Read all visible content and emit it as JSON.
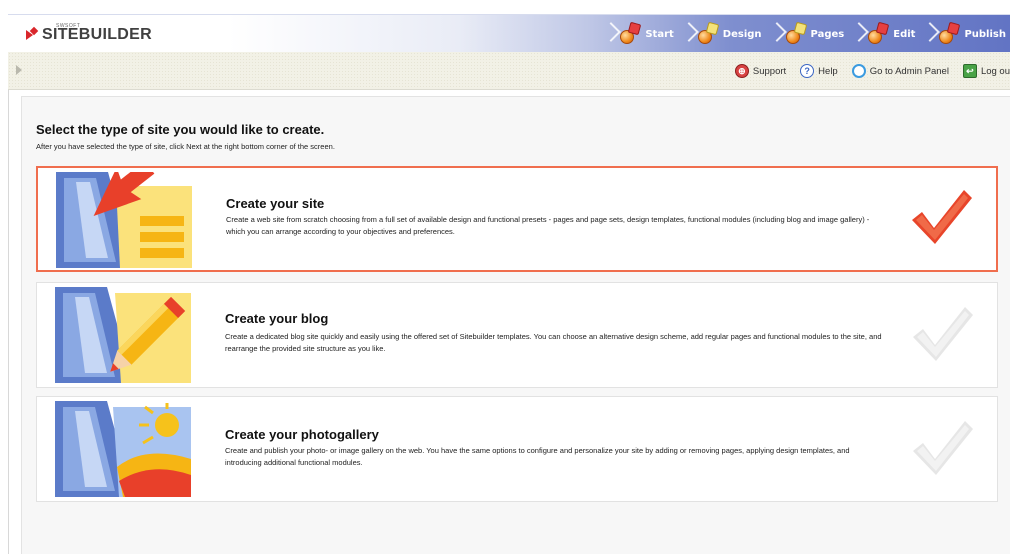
{
  "app": {
    "logo_text": "SITEBUILDER",
    "logo_small": "SWSOFT"
  },
  "wizard": {
    "steps": [
      {
        "label": "Start",
        "icon": "start-icon"
      },
      {
        "label": "Design",
        "icon": "design-icon"
      },
      {
        "label": "Pages",
        "icon": "pages-icon"
      },
      {
        "label": "Edit",
        "icon": "edit-icon"
      },
      {
        "label": "Publish",
        "icon": "publish-icon"
      }
    ]
  },
  "toolbar": {
    "support": "Support",
    "help": "Help",
    "admin_panel": "Go to Admin Panel",
    "logout": "Log ou"
  },
  "main": {
    "title": "Select the type of site you would like to create.",
    "subtitle": "After you have selected the type of site, click Next at the right bottom corner of the screen.",
    "options": [
      {
        "title": "Create your site",
        "description": "Create a web site from scratch choosing from a full set of available design and functional presets - pages and page sets, design templates, functional modules (including blog and image gallery) - which you can arrange according to your objectives and preferences.",
        "selected": true
      },
      {
        "title": "Create your blog",
        "description": "Create a dedicated blog site quickly and easily using the offered set of Sitebuilder templates. You can choose an alternative design scheme, add regular pages and functional modules to the site, and rearrange the provided site structure as you like.",
        "selected": false
      },
      {
        "title": "Create your photogallery",
        "description": "Create and publish your photo- or image gallery on the web. You have the same options to configure and personalize your site by adding or removing pages, applying design templates, and introducing additional functional modules.",
        "selected": false
      }
    ]
  },
  "colors": {
    "selected_border": "#f06e4e",
    "check_active": "#e8452a",
    "check_inactive": "#e6e6e6",
    "header_blue": "#6274c4"
  }
}
